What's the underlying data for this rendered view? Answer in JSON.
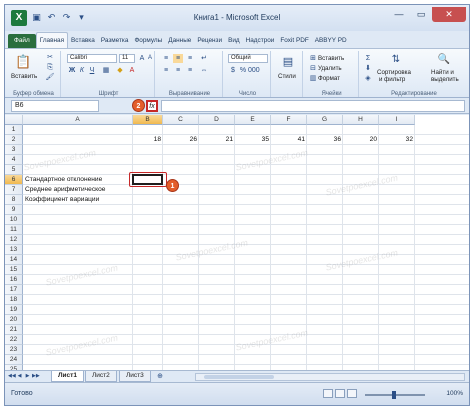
{
  "window": {
    "title": "Книга1 - Microsoft Excel",
    "logo": "X"
  },
  "tabs": [
    {
      "label": "Файл",
      "kind": "file"
    },
    {
      "label": "Главная",
      "kind": "active"
    },
    {
      "label": "Вставка"
    },
    {
      "label": "Разметка"
    },
    {
      "label": "Формулы"
    },
    {
      "label": "Данные"
    },
    {
      "label": "Рецензи"
    },
    {
      "label": "Вид"
    },
    {
      "label": "Надстрои"
    },
    {
      "label": "Foxit PDF"
    },
    {
      "label": "ABBYY PD"
    }
  ],
  "ribbon": {
    "paste_label": "Вставить",
    "font_name": "Calibri",
    "font_size": "11",
    "number_format": "Общий",
    "styles_label": "Стили",
    "insert_label": "Вставить",
    "delete_label": "Удалить",
    "format_label": "Формат",
    "sort_label_1": "Сортировка",
    "sort_label_2": "и фильтр",
    "find_label_1": "Найти и",
    "find_label_2": "выделить",
    "groups": {
      "clipboard": "Буфер обмена",
      "font": "Шрифт",
      "alignment": "Выравнивание",
      "number": "Число",
      "cells": "Ячейки",
      "editing": "Редактирование"
    }
  },
  "formula_bar": {
    "name_box": "B6",
    "fx": "fx"
  },
  "columns": [
    "A",
    "B",
    "C",
    "D",
    "E",
    "F",
    "G",
    "H",
    "I"
  ],
  "rows": [
    "1",
    "2",
    "3",
    "4",
    "5",
    "6",
    "7",
    "8",
    "9",
    "10",
    "11",
    "12",
    "13",
    "14",
    "15",
    "16",
    "17",
    "18",
    "19",
    "20",
    "21",
    "22",
    "23",
    "24",
    "25"
  ],
  "cells": {
    "B2": "18",
    "C2": "26",
    "D2": "21",
    "E2": "35",
    "F2": "41",
    "G2": "36",
    "H2": "20",
    "I2": "32",
    "A6": "Стандартное отклонение",
    "A7": "Среднее арифметическое",
    "A8": "Коэффициент вариации"
  },
  "markers": {
    "one": "1",
    "two": "2"
  },
  "watermark": "Sovetpoexcel.com",
  "sheets": [
    "Лист1",
    "Лист2",
    "Лист3"
  ],
  "status": {
    "ready": "Готово",
    "zoom": "100%"
  }
}
